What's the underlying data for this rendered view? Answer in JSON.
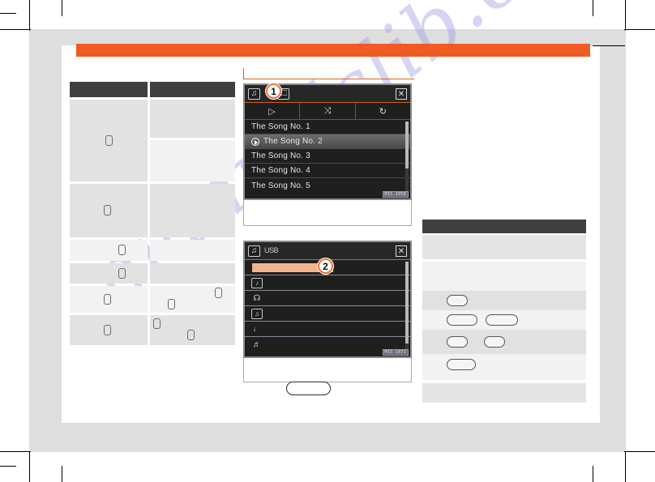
{
  "page": {
    "watermark": "manualslib.com",
    "accent_orange": "#f15a22",
    "rule_orange": "#d2691e",
    "header_dark": "#3f3f3f",
    "row_gray": "#e2e2e2",
    "row_light": "#f2f2f2"
  },
  "spec_table": {
    "headers": [
      "",
      ""
    ],
    "rows": [
      {
        "left": "",
        "right": [
          "",
          ""
        ]
      },
      {
        "left": "",
        "right": [
          ""
        ]
      },
      {
        "left": "",
        "right": [
          ""
        ]
      },
      {
        "left": "",
        "right": [
          ""
        ]
      },
      {
        "left": "",
        "right": [
          ""
        ]
      },
      {
        "left": "",
        "right": [
          ""
        ]
      }
    ]
  },
  "screen_audio": {
    "titlebar": {
      "note_icon": "♫",
      "folder_icon": "🗀",
      "close_label": "✕"
    },
    "toolbar": [
      {
        "icon": "▷",
        "name": "play"
      },
      {
        "icon": "⤨",
        "name": "shuffle"
      },
      {
        "icon": "↻",
        "name": "repeat"
      }
    ],
    "tracks": [
      {
        "title": "The Song No. 1",
        "playing": false
      },
      {
        "title": "The Song No. 2",
        "playing": true
      },
      {
        "title": "The Song No. 3",
        "playing": false
      },
      {
        "title": "The Song No. 4",
        "playing": false
      },
      {
        "title": "The Song No. 5",
        "playing": false
      }
    ],
    "ref_code": "M15-1058",
    "callout": "1"
  },
  "screen_usb": {
    "titlebar": {
      "note_icon": "♫",
      "usb_label": "USB",
      "close_label": "✕"
    },
    "menu_items": [
      {
        "icon": "",
        "name": "highlighted-entry",
        "highlight": true
      },
      {
        "icon": "♪",
        "name": "track-list",
        "highlight": false
      },
      {
        "icon": "☊",
        "name": "artist",
        "highlight": false
      },
      {
        "icon": "♫",
        "name": "album",
        "highlight": false
      },
      {
        "icon": "♩",
        "name": "genre",
        "highlight": false
      },
      {
        "icon": "♬",
        "name": "playlist",
        "highlight": false
      }
    ],
    "ref_code": "M15-1073",
    "callout": "2"
  },
  "right_panel": {
    "header": "",
    "rows": [
      {
        "buttons": [
          26
        ]
      },
      {
        "buttons": [
          38,
          40
        ]
      },
      {
        "buttons": [
          26,
          26
        ]
      },
      {
        "buttons": [
          36
        ]
      }
    ],
    "bullet_color": "#e8622a"
  },
  "pill_button": {
    "label": ""
  }
}
